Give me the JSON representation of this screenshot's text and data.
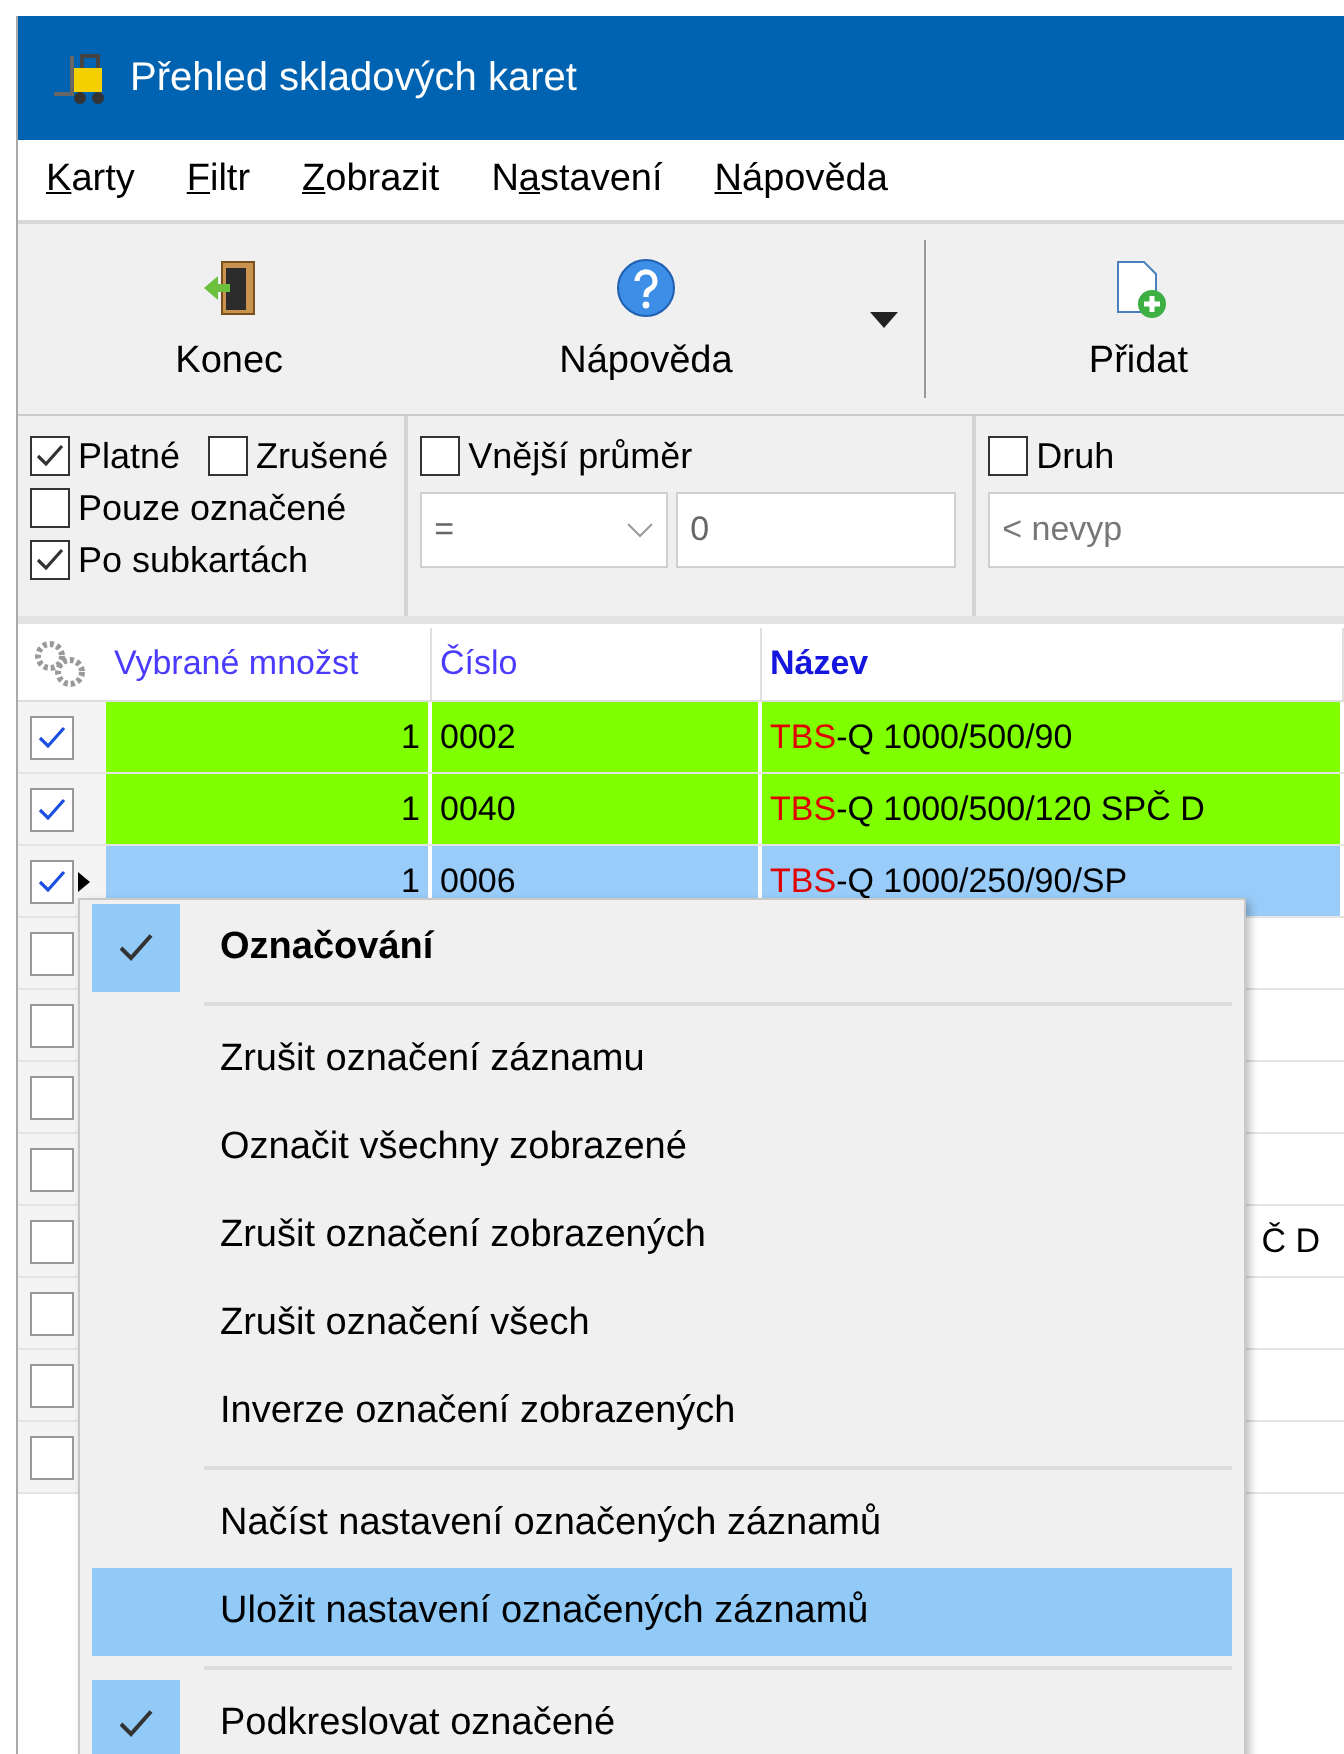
{
  "window": {
    "title": "Přehled skladových karet"
  },
  "menu_bar": [
    {
      "key": "K",
      "after": "arty"
    },
    {
      "key": "F",
      "after": "iltr"
    },
    {
      "key": "Z",
      "after": "obrazit"
    },
    {
      "before": "N",
      "key": "a",
      "after": "stavení"
    },
    {
      "key": "N",
      "after": "ápověda"
    }
  ],
  "toolbar": [
    {
      "kind": "exit",
      "label": "Konec",
      "dropdown": false
    },
    {
      "kind": "help",
      "label": "Nápověda",
      "dropdown": true
    },
    {
      "kind": "add",
      "label": "Přidat",
      "dropdown": false
    }
  ],
  "status_filters": [
    {
      "label": "Platné",
      "checked": true
    },
    {
      "label": "Zrušené",
      "checked": false
    },
    {
      "label": "Pouze označené",
      "checked": false
    },
    {
      "label": "Po subkartách",
      "checked": true
    }
  ],
  "filters": [
    {
      "kind": "number",
      "label": "Vnější průměr",
      "checked": false,
      "operator": "=",
      "value": "0"
    },
    {
      "kind": "text",
      "label": "Druh",
      "checked": false,
      "placeholder": "< nevyp"
    }
  ],
  "table": {
    "columns": [
      {
        "label": "Vybrané množst",
        "sorted": false
      },
      {
        "label": "Číslo",
        "sorted": false
      },
      {
        "label": "Název",
        "sorted": true
      }
    ],
    "rows": [
      {
        "checked": true,
        "selected": false,
        "quantity": "1",
        "number": "0002",
        "code": "TBS",
        "name": "-Q 1000/500/90"
      },
      {
        "checked": true,
        "selected": false,
        "quantity": "1",
        "number": "0040",
        "code": "TBS",
        "name": "-Q 1000/500/120 SPČ D"
      },
      {
        "checked": true,
        "selected": true,
        "quantity": "1",
        "number": "0006",
        "code": "TBS",
        "name": "-Q 1000/250/90/SP"
      },
      {
        "checked": false,
        "selected": false
      },
      {
        "checked": false,
        "selected": false
      },
      {
        "checked": false,
        "selected": false
      },
      {
        "checked": false,
        "selected": false
      },
      {
        "checked": false,
        "selected": false,
        "name_tail": "Č D"
      },
      {
        "checked": false,
        "selected": false
      },
      {
        "checked": false,
        "selected": false
      },
      {
        "checked": false,
        "selected": false
      }
    ]
  },
  "context_menu": {
    "items": [
      {
        "kind": "header",
        "label": "Označování",
        "checked": true,
        "selected": false
      },
      {
        "kind": "separator"
      },
      {
        "kind": "item",
        "label": "Zrušit označení záznamu",
        "selected": false
      },
      {
        "kind": "item",
        "label": "Označit všechny zobrazené",
        "selected": false
      },
      {
        "kind": "item",
        "label": "Zrušit označení zobrazených",
        "selected": false
      },
      {
        "kind": "item",
        "label": "Zrušit označení všech",
        "selected": false
      },
      {
        "kind": "item",
        "label": "Inverze označení zobrazených",
        "selected": false
      },
      {
        "kind": "separator"
      },
      {
        "kind": "item",
        "label": "Načíst nastavení označených záznamů",
        "selected": false
      },
      {
        "kind": "item",
        "label": "Uložit nastavení označených záznamů",
        "selected": true
      },
      {
        "kind": "separator"
      },
      {
        "kind": "check",
        "label": "Podkreslovat označené",
        "checked": true,
        "selected": false
      }
    ]
  }
}
